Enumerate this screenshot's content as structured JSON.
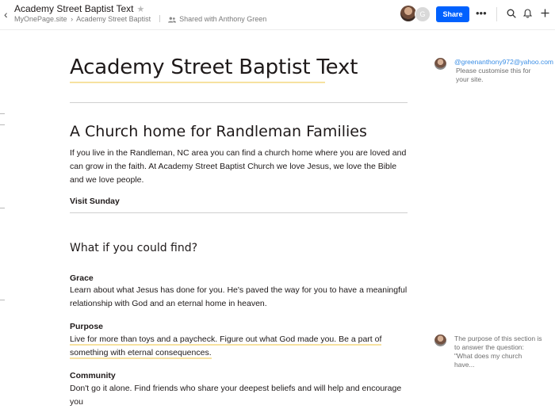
{
  "header": {
    "title": "Academy Street Baptist Text",
    "breadcrumb": [
      "MyOnePage.site",
      "Academy Street Baptist"
    ],
    "breadcrumb_sep": "›",
    "shared_with": "Shared with Anthony Green",
    "avatar_initial": "G",
    "share_label": "Share",
    "more_label": "•••"
  },
  "doc": {
    "title": "Academy Street Baptist Text",
    "heading1": "A Church home for Randleman Families",
    "intro": "If you live in the Randleman, NC area you can find a church home where you are loved and can grow in the faith. At Academy Street Baptist Church we love Jesus, we love the Bible and we love people.",
    "visit": "Visit Sunday",
    "heading2": "What if you could find?",
    "sections": [
      {
        "title": "Grace",
        "body": "Learn about what Jesus has done for you.  He's paved the way for you to have a meaningful relationship with God and an eternal home in heaven."
      },
      {
        "title": "Purpose",
        "body": "Live for more than toys and a paycheck.  Figure out what God made you.  Be a part of something with eternal consequences."
      },
      {
        "title": "Community",
        "body": "Don't go it alone.  Find friends who share your deepest beliefs and will help and encourage you"
      }
    ]
  },
  "comments": [
    {
      "author": "@greenanthony972@yahoo.com",
      "text": "Please customise this for your site."
    },
    {
      "text": "The purpose of this section is to answer the question: \"What does my church have..."
    }
  ],
  "colors": {
    "accent": "#0061fe",
    "highlight": "#f7e2a0",
    "link": "#3a8ee6"
  }
}
